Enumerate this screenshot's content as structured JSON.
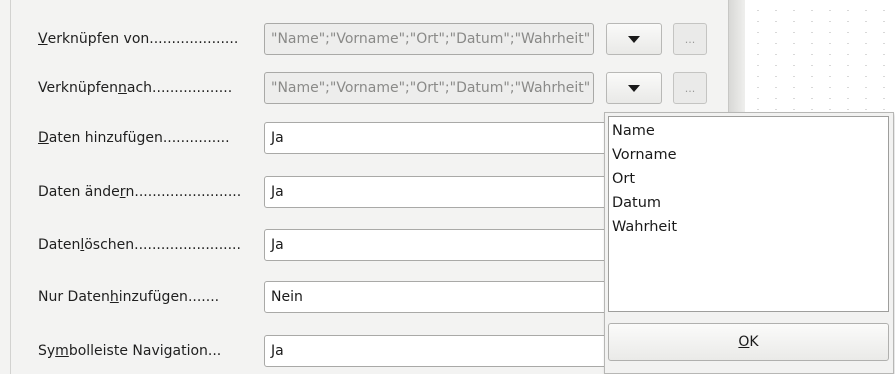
{
  "rows": [
    {
      "label": "Verknüpfen von",
      "value": "\"Name\";\"Vorname\";\"Ort\";\"Datum\";\"Wahrheit\""
    },
    {
      "label": "Verknüpfen nach",
      "value": "\"Name\";\"Vorname\";\"Ort\";\"Datum\";\"Wahrheit\""
    },
    {
      "label": "Daten hinzufügen",
      "value": "Ja"
    },
    {
      "label": "Daten ändern",
      "value": "Ja"
    },
    {
      "label": "Daten löschen",
      "value": "Ja"
    },
    {
      "label": "Nur Daten hinzufügen",
      "value": "Nein"
    },
    {
      "label": "Symbolleiste Navigation",
      "value": "Ja"
    }
  ],
  "labels": {
    "r0": {
      "a": "",
      "u": "V",
      "b": "erknüpfen von"
    },
    "r1": {
      "a": "Verknüpfen ",
      "u": "n",
      "b": "ach"
    },
    "r2": {
      "a": "",
      "u": "D",
      "b": "aten hinzufügen"
    },
    "r3": {
      "a": "Daten ände",
      "u": "r",
      "b": "n"
    },
    "r4": {
      "a": "Daten ",
      "u": "l",
      "b": "öschen"
    },
    "r5": {
      "a": "Nur Daten ",
      "u": "h",
      "b": "inzufügen"
    },
    "r6": {
      "a": "Sy",
      "u": "m",
      "b": "bolleiste Navigation"
    }
  },
  "label_dots": {
    "r0": "....................",
    "r1": "..................",
    "r2": "...............",
    "r3": "........................",
    "r4": "........................",
    "r5": ".......",
    "r6": "..."
  },
  "link_button_label": "...",
  "dropdown": {
    "items": [
      "Name",
      "Vorname",
      "Ort",
      "Datum",
      "Wahrheit"
    ],
    "ok": {
      "mnemonic": "O",
      "rest": "K"
    }
  }
}
